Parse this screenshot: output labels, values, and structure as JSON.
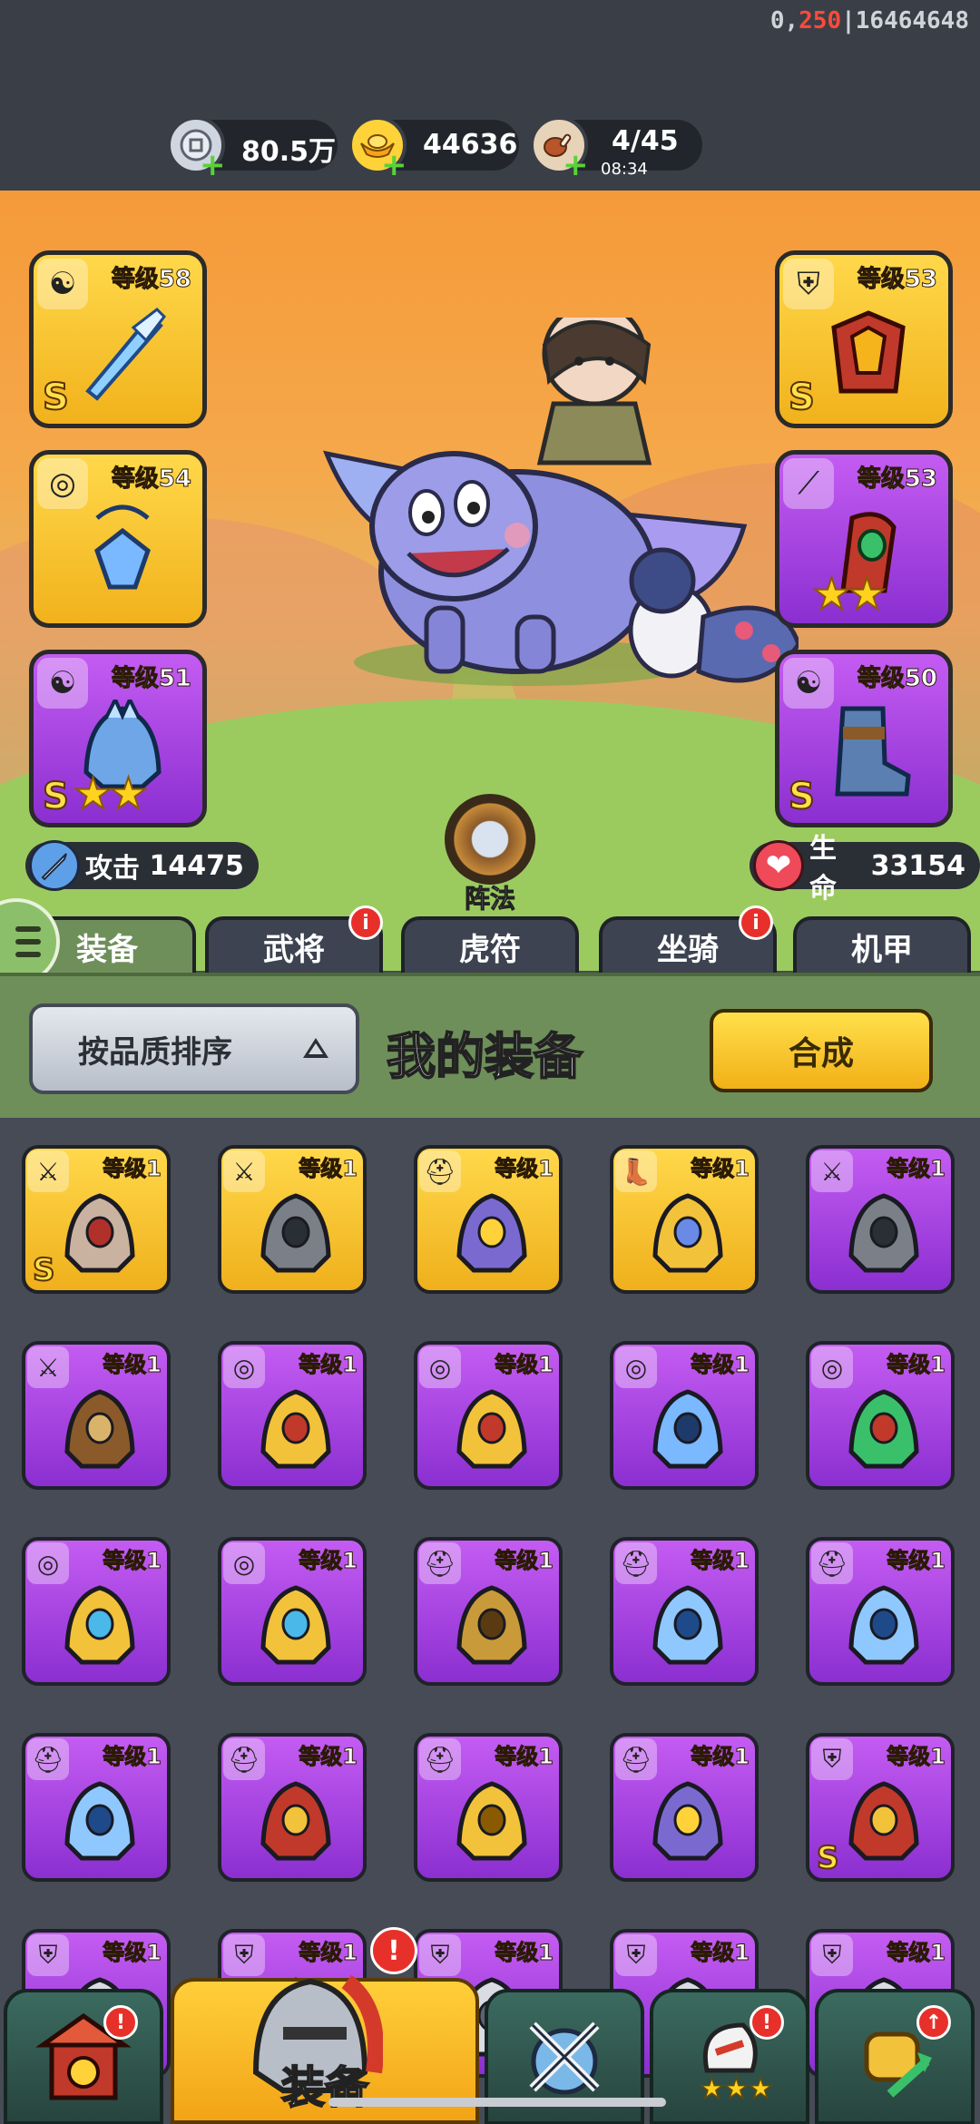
{
  "debug": {
    "prefix": "0,",
    "highlight": "250",
    "suffix": "|16464648"
  },
  "resources": [
    {
      "name": "silver",
      "icon": "silver-coin-icon",
      "value": "80.5万",
      "timer": ""
    },
    {
      "name": "gold",
      "icon": "gold-ingot-icon",
      "value": "44636",
      "timer": ""
    },
    {
      "name": "stamina",
      "icon": "drumstick-icon",
      "value": "4/45",
      "timer": "08:34"
    }
  ],
  "hero_equipment": {
    "left": [
      {
        "level": "等级58",
        "rarity": "gold",
        "type_icon": "yin-yang-icon",
        "item_icon": "ice-sword-icon",
        "grade": "S",
        "stars": ""
      },
      {
        "level": "等级54",
        "rarity": "gold",
        "type_icon": "medal-icon",
        "item_icon": "crystal-amulet-icon",
        "grade": "",
        "stars": ""
      },
      {
        "level": "等级51",
        "rarity": "purple",
        "type_icon": "yin-yang-icon",
        "item_icon": "ice-helmet-icon",
        "grade": "S",
        "stars": "★★"
      }
    ],
    "right": [
      {
        "level": "等级53",
        "rarity": "gold",
        "type_icon": "armor-icon",
        "item_icon": "flame-armor-icon",
        "grade": "S",
        "stars": ""
      },
      {
        "level": "等级53",
        "rarity": "purple",
        "type_icon": "bracer-icon",
        "item_icon": "gem-bracer-icon",
        "grade": "",
        "stars": "★★"
      },
      {
        "level": "等级50",
        "rarity": "purple",
        "type_icon": "yin-yang-icon",
        "item_icon": "ice-boots-icon",
        "grade": "S",
        "stars": ""
      }
    ]
  },
  "stats": {
    "attack_label": "攻击",
    "attack_value": "14475",
    "hp_label": "生命",
    "hp_value": "33154"
  },
  "formation_label": "阵法",
  "tabs": [
    {
      "label": "装备",
      "active": true,
      "badge": ""
    },
    {
      "label": "武将",
      "active": false,
      "badge": "i"
    },
    {
      "label": "虎符",
      "active": false,
      "badge": ""
    },
    {
      "label": "坐骑",
      "active": false,
      "badge": "i"
    },
    {
      "label": "机甲",
      "active": false,
      "badge": ""
    }
  ],
  "panel": {
    "sort_label": "按品质排序",
    "title": "我的装备",
    "craft_label": "合成"
  },
  "inventory": [
    {
      "level": "等级1",
      "rarity": "gold",
      "type_icon": "weapon-icon",
      "item_icon": "jeweled-sickle-icon",
      "grade": "S"
    },
    {
      "level": "等级1",
      "rarity": "gold",
      "type_icon": "weapon-icon",
      "item_icon": "shuriken-icon",
      "grade": ""
    },
    {
      "level": "等级1",
      "rarity": "gold",
      "type_icon": "helmet-icon",
      "item_icon": "jeweled-helmet-icon",
      "grade": ""
    },
    {
      "level": "等级1",
      "rarity": "gold",
      "type_icon": "boot-icon",
      "item_icon": "golden-boots-icon",
      "grade": ""
    },
    {
      "level": "等级1",
      "rarity": "purple",
      "type_icon": "weapon-icon",
      "item_icon": "shuriken-icon",
      "grade": ""
    },
    {
      "level": "等级1",
      "rarity": "purple",
      "type_icon": "weapon-icon",
      "item_icon": "crossbow-icon",
      "grade": ""
    },
    {
      "level": "等级1",
      "rarity": "purple",
      "type_icon": "medal-icon",
      "item_icon": "crescent-amulet-icon",
      "grade": ""
    },
    {
      "level": "等级1",
      "rarity": "purple",
      "type_icon": "medal-icon",
      "item_icon": "crescent-amulet-icon",
      "grade": ""
    },
    {
      "level": "等级1",
      "rarity": "purple",
      "type_icon": "medal-icon",
      "item_icon": "crystal-amulet-icon",
      "grade": ""
    },
    {
      "level": "等级1",
      "rarity": "purple",
      "type_icon": "medal-icon",
      "item_icon": "emerald-amulet-icon",
      "grade": ""
    },
    {
      "level": "等级1",
      "rarity": "purple",
      "type_icon": "medal-icon",
      "item_icon": "gem-necklace-icon",
      "grade": ""
    },
    {
      "level": "等级1",
      "rarity": "purple",
      "type_icon": "medal-icon",
      "item_icon": "gem-necklace-icon",
      "grade": ""
    },
    {
      "level": "等级1",
      "rarity": "purple",
      "type_icon": "helmet-icon",
      "item_icon": "bronze-helmet-icon",
      "grade": ""
    },
    {
      "level": "等级1",
      "rarity": "purple",
      "type_icon": "helmet-icon",
      "item_icon": "ice-helmet-icon",
      "grade": ""
    },
    {
      "level": "等级1",
      "rarity": "purple",
      "type_icon": "helmet-icon",
      "item_icon": "ice-helmet-icon",
      "grade": ""
    },
    {
      "level": "等级1",
      "rarity": "purple",
      "type_icon": "helmet-icon",
      "item_icon": "ice-helmet-icon",
      "grade": ""
    },
    {
      "level": "等级1",
      "rarity": "purple",
      "type_icon": "helmet-icon",
      "item_icon": "red-helmet-icon",
      "grade": ""
    },
    {
      "level": "等级1",
      "rarity": "purple",
      "type_icon": "helmet-icon",
      "item_icon": "golden-helmet-icon",
      "grade": ""
    },
    {
      "level": "等级1",
      "rarity": "purple",
      "type_icon": "helmet-icon",
      "item_icon": "jeweled-helmet-icon",
      "grade": ""
    },
    {
      "level": "等级1",
      "rarity": "purple",
      "type_icon": "armor-icon",
      "item_icon": "flame-armor-icon",
      "grade": "S"
    },
    {
      "level": "等级1",
      "rarity": "purple",
      "type_icon": "armor-icon",
      "item_icon": "armor-icon",
      "grade": ""
    },
    {
      "level": "等级1",
      "rarity": "purple",
      "type_icon": "armor-icon",
      "item_icon": "armor-icon",
      "grade": ""
    },
    {
      "level": "等级1",
      "rarity": "purple",
      "type_icon": "armor-icon",
      "item_icon": "armor-icon",
      "grade": ""
    },
    {
      "level": "等级1",
      "rarity": "purple",
      "type_icon": "armor-icon",
      "item_icon": "armor-icon",
      "grade": ""
    },
    {
      "level": "等级1",
      "rarity": "purple",
      "type_icon": "armor-icon",
      "item_icon": "armor-icon",
      "grade": ""
    }
  ],
  "bottom_nav": [
    {
      "name": "city",
      "icon": "gate-tower-icon",
      "label": "",
      "badge": "!"
    },
    {
      "name": "equipment",
      "icon": "knight-helmet-icon",
      "label": "装备",
      "badge": "!"
    },
    {
      "name": "battle",
      "icon": "crossed-swords-icon",
      "label": "",
      "badge": ""
    },
    {
      "name": "heroes",
      "icon": "hero-stars-icon",
      "label": "",
      "badge": "!"
    },
    {
      "name": "upgrade",
      "icon": "power-fist-icon",
      "label": "",
      "badge": "↑"
    }
  ],
  "colors": {
    "gold_rarity": "#f5c030",
    "purple_rarity": "#a646e2",
    "panel_green": "#6e8f5a",
    "badge_red": "#e8302a"
  }
}
